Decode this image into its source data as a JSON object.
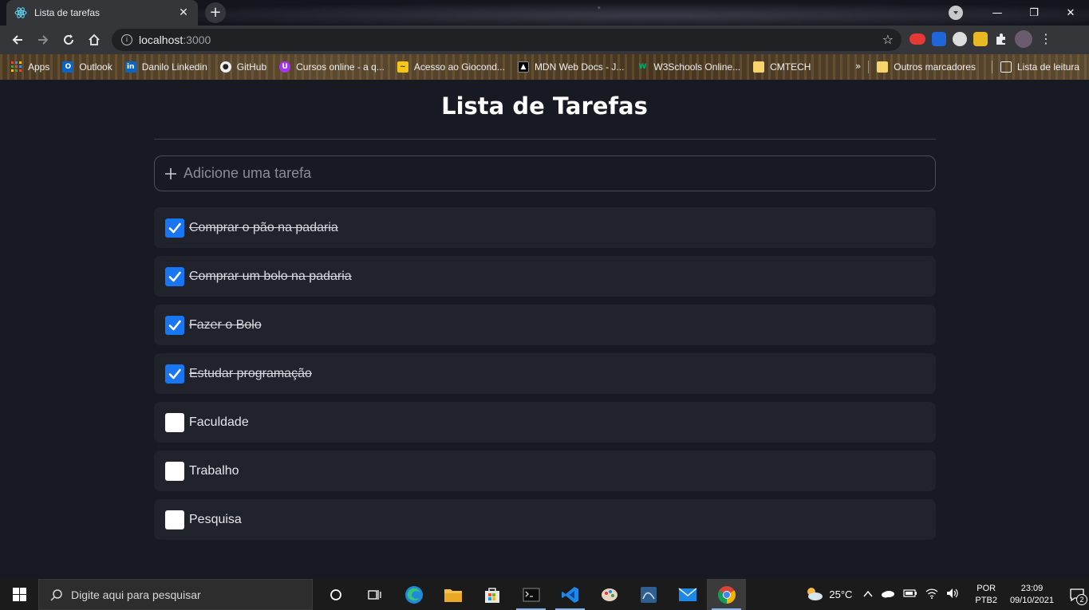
{
  "browser": {
    "tab_title": "Lista de tarefas",
    "new_tab_symbol": "+",
    "close_symbol": "✕",
    "url_host": "localhost",
    "url_port": ":3000",
    "window_controls": {
      "minimize": "—",
      "maximize": "❐",
      "close": "✕"
    }
  },
  "bookmarks": {
    "items": [
      {
        "label": "Apps",
        "icon": "apps-grid-icon"
      },
      {
        "label": "Outlook",
        "icon": "outlook-icon"
      },
      {
        "label": "Danilo Linkedin",
        "icon": "linkedin-icon"
      },
      {
        "label": "GitHub",
        "icon": "github-icon"
      },
      {
        "label": "Cursos online - a q...",
        "icon": "udemy-icon"
      },
      {
        "label": "Acesso ao Giocond...",
        "icon": "chart-icon"
      },
      {
        "label": "MDN Web Docs - J...",
        "icon": "mdn-icon"
      },
      {
        "label": "W3Schools Online...",
        "icon": "w3schools-icon"
      },
      {
        "label": "CMTECH",
        "icon": "folder-icon"
      }
    ],
    "more": "»",
    "other_label": "Outros marcadores",
    "reading_list_label": "Lista de leitura"
  },
  "page": {
    "title": "Lista de Tarefas",
    "add_placeholder": "Adicione uma tarefa",
    "tasks": [
      {
        "text": "Comprar o pão na padaria",
        "done": true
      },
      {
        "text": "Comprar um bolo na padaria",
        "done": true
      },
      {
        "text": "Fazer o Bolo",
        "done": true
      },
      {
        "text": "Estudar programação",
        "done": true
      },
      {
        "text": "Faculdade",
        "done": false
      },
      {
        "text": "Trabalho",
        "done": false
      },
      {
        "text": "Pesquisa",
        "done": false
      }
    ]
  },
  "taskbar": {
    "search_placeholder": "Digite aqui para pesquisar",
    "temperature": "25°C",
    "lang_top": "POR",
    "lang_bottom": "PTB2",
    "time": "23:09",
    "date": "09/10/2021",
    "notification_count": "2"
  },
  "colors": {
    "page_bg": "#181a23",
    "task_bg": "#20222c",
    "checkbox_checked": "#1976f2"
  }
}
